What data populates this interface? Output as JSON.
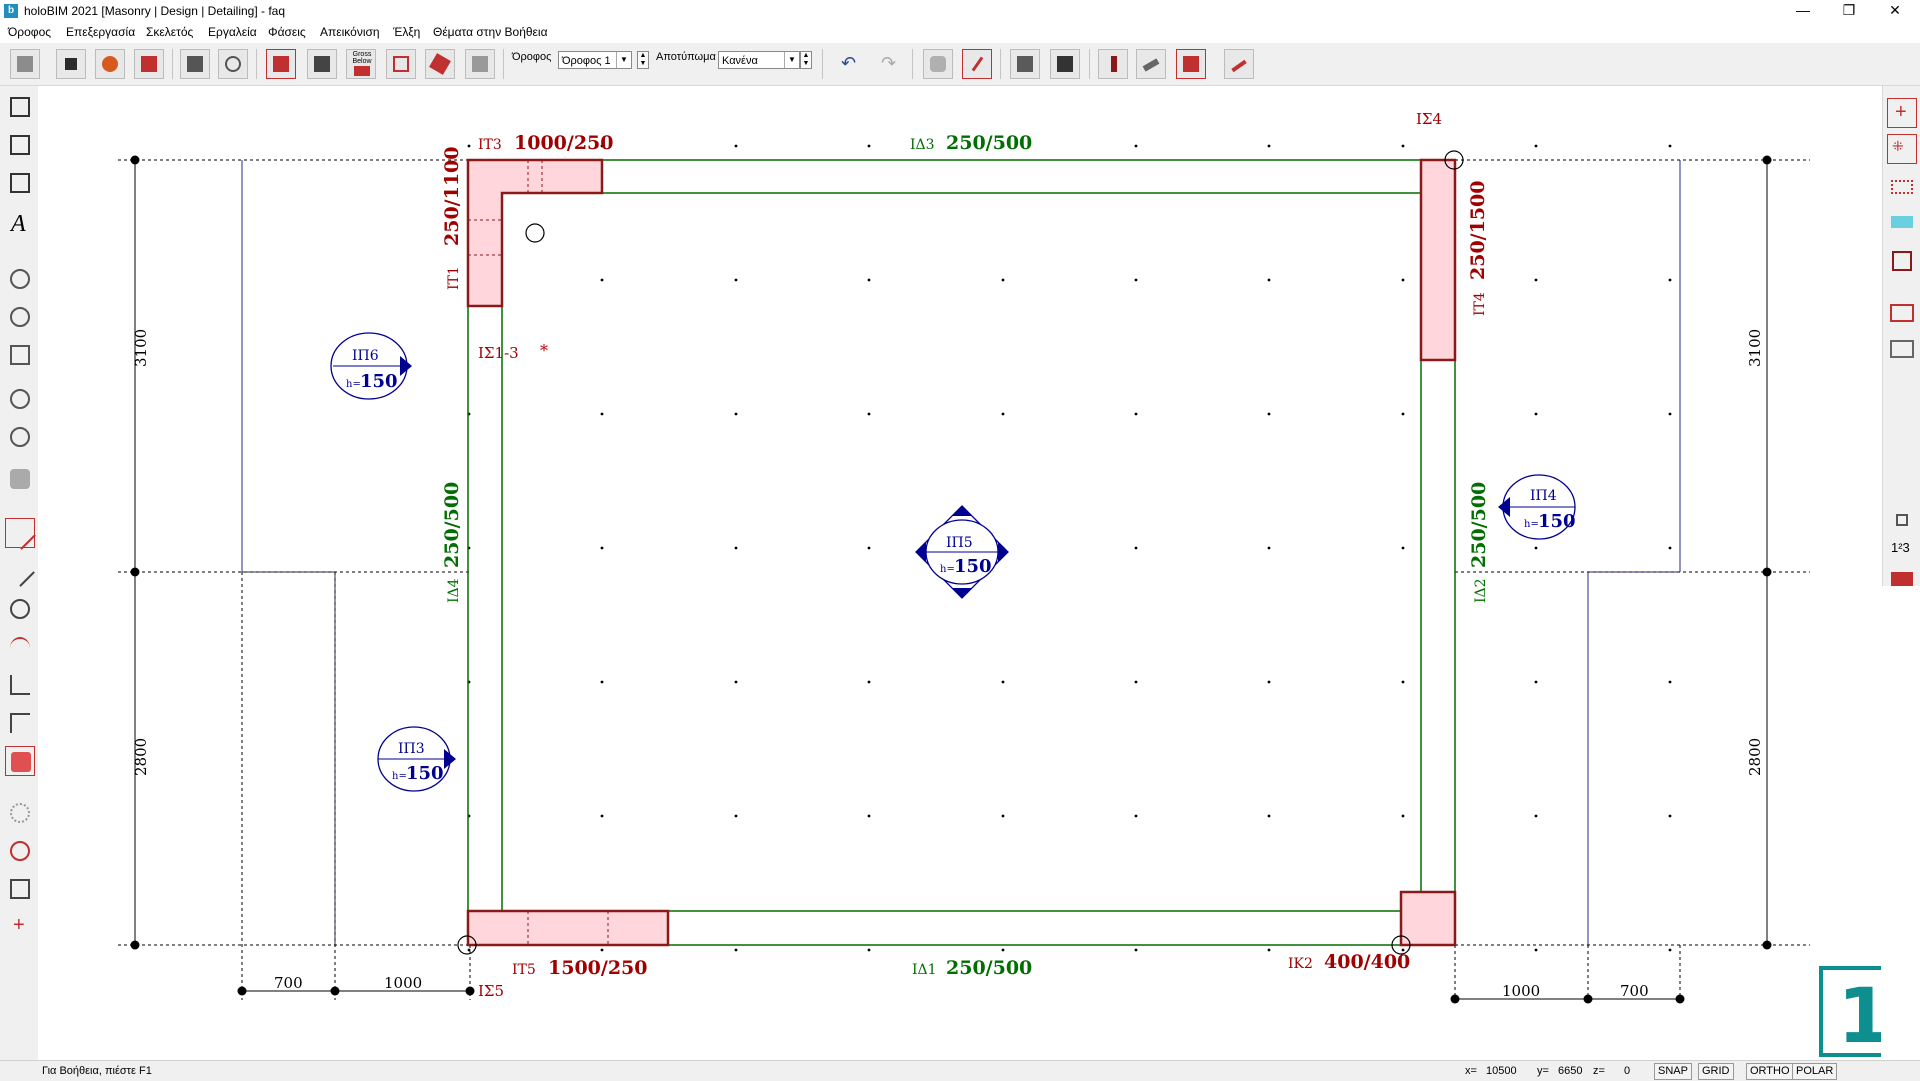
{
  "window": {
    "title": "holoBIM 2021 [Masonry | Design | Detailing] - faq",
    "app_icon": "b",
    "minimize": "—",
    "restore": "❐",
    "close": "✕"
  },
  "menu": [
    "Όροφος",
    "Επεξεργασία",
    "Σκελετός",
    "Εργαλεία",
    "Φάσεις",
    "Απεικόνιση",
    "Έλξη",
    "Θέματα στην Βοήθεια"
  ],
  "toolbar": {
    "floor_label": "Όροφος",
    "floor_value": "Όροφος 1",
    "result_label": "Αποτύπωμα",
    "result_value": "Κανένα",
    "gross_label": "Gross Below",
    "icons": [
      "building-icon",
      "save-icon",
      "gears-icon",
      "close-doc-icon",
      "print-icon",
      "preview-icon",
      "section-icon",
      "trim-icon",
      "gross-below-icon",
      "delete-icon",
      "cut-icon",
      "wall-pattern-icon",
      "undo-icon",
      "redo-icon",
      "pan-hand-icon",
      "pencil-icon",
      "3d-view-icon",
      "facade-icon",
      "column-icon",
      "beam-icon",
      "slab-icon",
      "stair-icon"
    ]
  },
  "left_tools": [
    "edit-beam-icon",
    "edit-column-icon",
    "edit-wall-icon",
    "text-icon",
    "zoom-window-icon",
    "zoom-center-icon",
    "zoom-extents-icon",
    "zoom-in-icon",
    "zoom-plus-icon",
    "pan-icon",
    "line-icon",
    "polyline-icon",
    "circle-icon",
    "arc-icon",
    "perpendicular-icon",
    "fillet-icon",
    "eraser-icon",
    "sun-icon",
    "magnet-icon",
    "book-icon",
    "cross-icon"
  ],
  "right_tools": [
    "snap-plus-icon",
    "snap-grid-icon",
    "dotted-rect-icon",
    "elevation-icon",
    "fill-rect-icon",
    "compact-icon",
    "zdw-icon",
    "lock-icon",
    "numbering-icon",
    "steps-icon"
  ],
  "right_tools_text": {
    "numbering": "1²3"
  },
  "colors": {
    "wall_red": "#a00000",
    "beam_green": "#006e00",
    "slab_blue": "#000090",
    "column_fill": "#ffd6dc",
    "grid_blue": "#2a2a80"
  },
  "drawing": {
    "labels": {
      "it3": "ΙΤ3",
      "it3_dim": "1000/250",
      "id3": "ΙΔ3",
      "id3_dim": "250/500",
      "iz4": "ΙΣ4",
      "it1": "ΙΤ1",
      "it1_dim": "250/1100",
      "it4": "ΙΤ4",
      "it4_dim": "250/1500",
      "iz13": "ΙΣ1-3",
      "star": "*",
      "id4": "ΙΔ4",
      "id4_dim": "250/500",
      "id2": "ΙΔ2",
      "id2_dim": "250/500",
      "it5": "ΙΤ5",
      "it5_dim": "1500/250",
      "iz5": "ΙΣ5",
      "id1": "ΙΔ1",
      "id1_dim": "250/500",
      "ik2": "ΙΚ2",
      "ik2_dim": "400/400"
    },
    "slabs": [
      {
        "name": "ΙΠ6",
        "h": "150"
      },
      {
        "name": "ΙΠ5",
        "h": "150"
      },
      {
        "name": "ΙΠ4",
        "h": "150"
      },
      {
        "name": "ΙΠ3",
        "h": "150"
      }
    ],
    "slab_h_prefix": "h=",
    "dims": {
      "left_top": "3100",
      "left_bottom": "2800",
      "right_top": "3100",
      "right_bottom": "2800",
      "bottom_left_a": "700",
      "bottom_left_b": "1000",
      "bottom_right_a": "1000",
      "bottom_right_b": "700"
    },
    "floor_number": "1"
  },
  "status": {
    "help": "Για Βοήθεια, πιέστε F1",
    "x_label": "x=",
    "x_value": "10500",
    "y_label": "y=",
    "y_value": "6650",
    "z_label": "z=",
    "z_value": "0",
    "snap": "SNAP",
    "grid": "GRID",
    "ortho": "ORTHO",
    "polar": "POLAR"
  }
}
